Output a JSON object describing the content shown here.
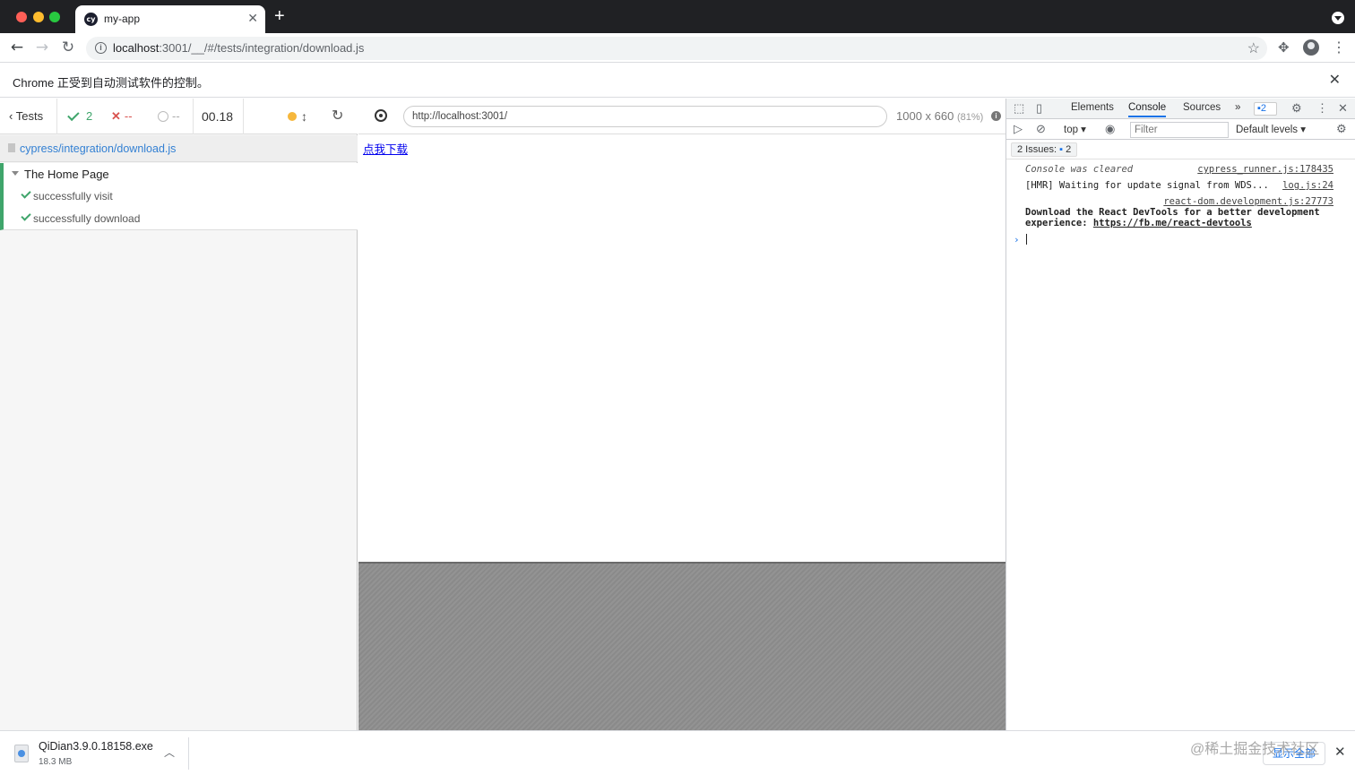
{
  "browser": {
    "tab_title": "my-app",
    "tab_favicon_text": "cy",
    "new_tab_label": "+",
    "url_host": "localhost",
    "url_rest": ":3001/__/#/tests/integration/download.js",
    "infobar_text": "Chrome 正受到自动测试软件的控制。"
  },
  "reporter": {
    "tests_label": "Tests",
    "passed": "2",
    "failed": "--",
    "pending": "--",
    "duration": "00.18",
    "spec_file": "cypress/integration/download.js",
    "suite_title": "The Home Page",
    "tests": [
      {
        "title": "successfully visit",
        "state": "passed"
      },
      {
        "title": "successfully download",
        "state": "passed"
      }
    ]
  },
  "aut": {
    "url": "http://localhost:3001/",
    "viewport": "1000 x 660",
    "scale": "(81%)",
    "link_text": "点我下载"
  },
  "devtools": {
    "tabs": [
      "Elements",
      "Console",
      "Sources"
    ],
    "active_tab": "Console",
    "more_tabs": "»",
    "issues_badge": "2",
    "context": "top ▾",
    "filter_placeholder": "Filter",
    "levels": "Default levels ▾",
    "issues_label": "2 Issues:",
    "issues_count": "2",
    "console": [
      {
        "message": "Console was cleared",
        "source": "cypress_runner.js:178435"
      },
      {
        "message": "[HMR] Waiting for update signal from WDS...",
        "source": "log.js:24"
      },
      {
        "message": "Download the React DevTools for a better development experience: ",
        "link": "https://fb.me/react-devtools",
        "source": "react-dom.development.js:27773"
      }
    ],
    "prompt": "›"
  },
  "downloads": {
    "file_name": "QiDian3.9.0.18158.exe",
    "file_size": "18.3 MB",
    "show_all": "显示全部",
    "watermark": "@稀土掘金技术社区"
  },
  "colors": {
    "passed": "#3fa56b",
    "failed": "#d9534f",
    "link": "#3380d3",
    "devtools_accent": "#1a73e8"
  }
}
